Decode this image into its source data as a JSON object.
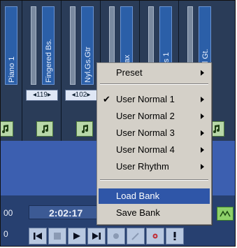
{
  "mixer": {
    "strips": [
      {
        "name": "Piano 1",
        "program": "",
        "note_icon": "music-note-icon"
      },
      {
        "name": "Fingered Bs.",
        "program": "119",
        "note_icon": "music-note-icon"
      },
      {
        "name": "Nyl.Gs.Gtr",
        "program": "102",
        "note_icon": "music-note-icon"
      },
      {
        "name": "Ten Sax",
        "program": "",
        "note_icon": "music-note-icon"
      },
      {
        "name": "Strings 1",
        "program": "",
        "note_icon": "music-note-icon"
      },
      {
        "name": "Muted Gt.",
        "program": "",
        "note_icon": "music-note-icon"
      }
    ]
  },
  "transport": {
    "time": "2:02:17",
    "left_digits": [
      "00",
      "0"
    ]
  },
  "menu": {
    "items": [
      {
        "label": "Preset",
        "submenu": true,
        "checked": false
      },
      {
        "label": "User Normal 1",
        "submenu": true,
        "checked": true
      },
      {
        "label": "User Normal 2",
        "submenu": true,
        "checked": false
      },
      {
        "label": "User Normal 3",
        "submenu": true,
        "checked": false
      },
      {
        "label": "User Normal 4",
        "submenu": true,
        "checked": false
      },
      {
        "label": "User Rhythm",
        "submenu": true,
        "checked": false
      },
      {
        "label": "Load Bank",
        "submenu": false,
        "checked": false,
        "highlighted": true
      },
      {
        "label": "Save Bank",
        "submenu": false,
        "checked": false
      }
    ]
  },
  "colors": {
    "menu_highlight": "#2f56a8",
    "mixer_bg": "#1a2c45",
    "lower_panel": "#3c5fb0"
  }
}
